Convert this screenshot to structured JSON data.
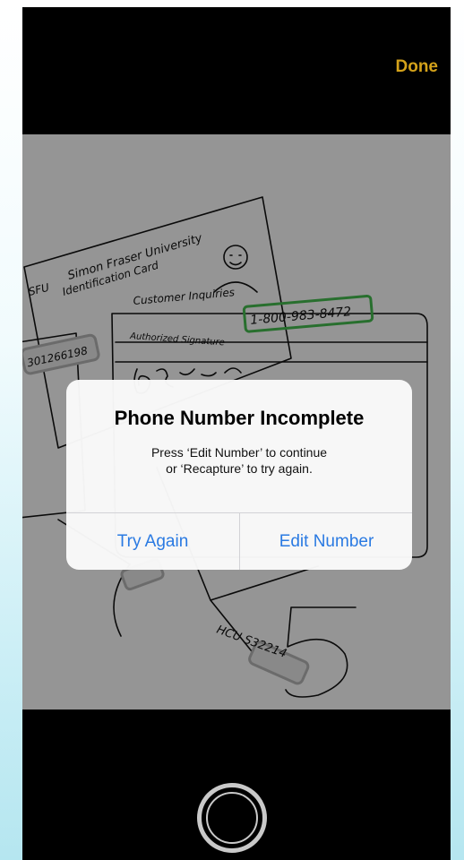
{
  "header": {
    "done_label": "Done"
  },
  "camera": {
    "scene_texts": {
      "card1_label": "SFU",
      "card1_name": "Simon Fraser University",
      "card1_sub": "Identification Card",
      "customer_inquiries": "Customer Inquiries",
      "phone_detected": "1-800-983-8472",
      "authorized_signature": "Authorized Signature",
      "card_number": "301266198",
      "code_bottom": "HCU S32214"
    },
    "highlight_color": "#3fae49"
  },
  "alert": {
    "title": "Phone Number Incomplete",
    "message_line1": "Press ‘Edit Number’ to continue",
    "message_line2": "or ‘Recapture’ to try again.",
    "button_left": "Try Again",
    "button_right": "Edit Number",
    "button_color": "#2a7ae2"
  },
  "footer": {
    "shutter_icon": "shutter-icon"
  },
  "colors": {
    "done": "#d4a21a",
    "background_gradient_end": "#b5e6f0"
  }
}
